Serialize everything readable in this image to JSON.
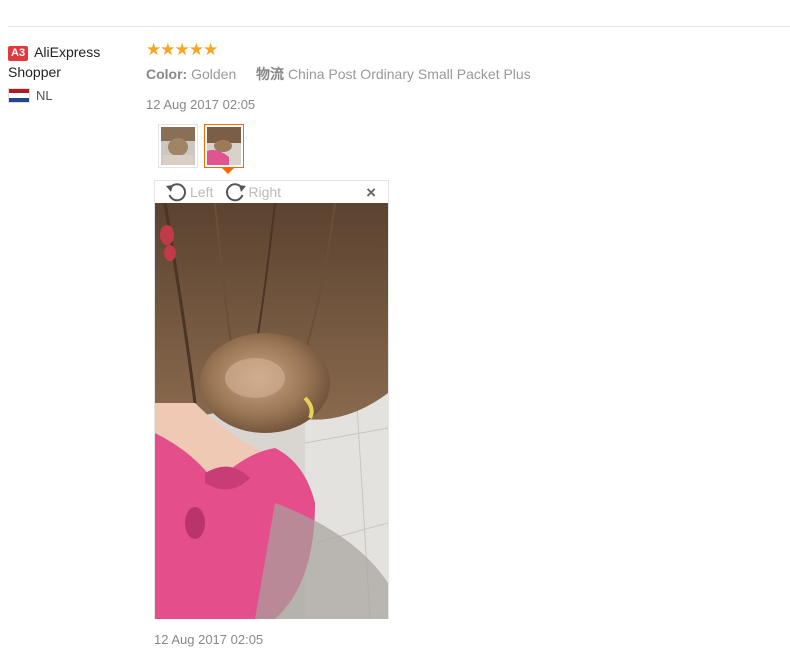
{
  "buyer": {
    "level_badge": "A3",
    "name_line1": "AliExpress",
    "name_line2": "Shopper",
    "country": "NL"
  },
  "review": {
    "stars": "★★★★★",
    "rating": 5,
    "color_label": "Color:",
    "color_value": "Golden",
    "logistics_label": "物流",
    "logistics_value": "China Post Ordinary Small Packet Plus",
    "date": "12 Aug 2017 02:05"
  },
  "viewer": {
    "rotate_left": "Left",
    "rotate_right": "Right",
    "close": "×",
    "date": "12 Aug 2017 02:05"
  },
  "colors": {
    "accent": "#f60",
    "badge": "#e4393c",
    "star": "#f5a623"
  }
}
